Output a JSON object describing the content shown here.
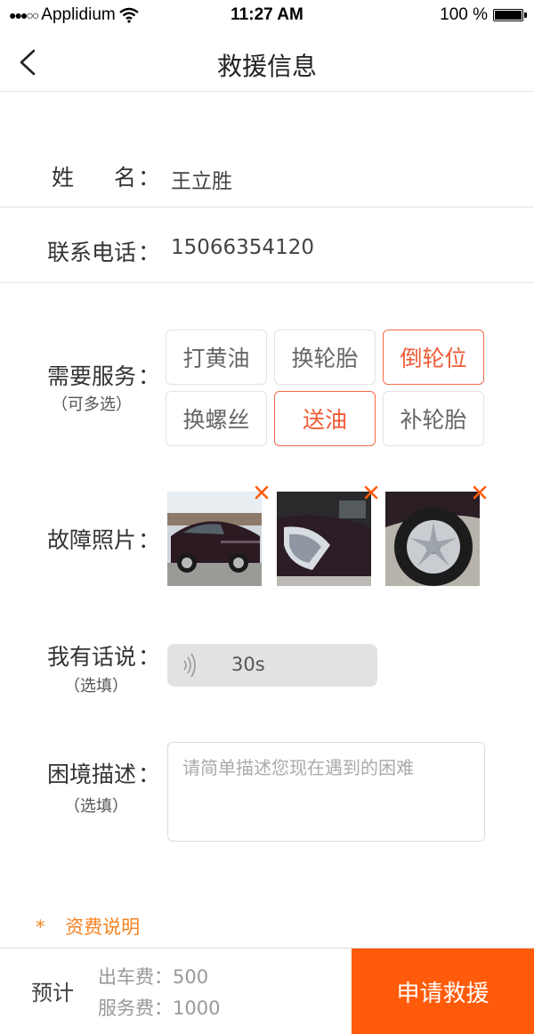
{
  "status_bar": {
    "signal_dots": "●●●○○",
    "carrier": "Applidium",
    "time": "11:27 AM",
    "battery": "100 %"
  },
  "nav": {
    "title": "救援信息"
  },
  "form": {
    "name_label_1": "姓",
    "name_label_2": "名",
    "colon": "：",
    "name_value": "王立胜",
    "phone_label": "联系电话",
    "phone_value": "15066354120",
    "service_label": "需要服务",
    "service_hint": "（可多选）",
    "services": [
      {
        "label": "打黄油",
        "selected": false
      },
      {
        "label": "换轮胎",
        "selected": false
      },
      {
        "label": "倒轮位",
        "selected": true
      },
      {
        "label": "换螺丝",
        "selected": false
      },
      {
        "label": "送油",
        "selected": true
      },
      {
        "label": "补轮胎",
        "selected": false
      }
    ],
    "photos_label": "故障照片",
    "photos": [
      {
        "subject": "car-side-photo"
      },
      {
        "subject": "car-headlight-photo"
      },
      {
        "subject": "car-wheel-photo"
      }
    ],
    "voice_label": "我有话说",
    "voice_hint": "（选填）",
    "voice_duration": "30s",
    "desc_label": "困境描述",
    "desc_hint": "（选填）",
    "desc_placeholder": "请简单描述您现在遇到的困难"
  },
  "fee_note": {
    "star": "*",
    "text": "资费说明"
  },
  "bottom_bar": {
    "estimate_label": "预计",
    "trip_fee_label": "出车费：",
    "trip_fee_value": "500",
    "service_fee_label": "服务费：",
    "service_fee_value": "1000",
    "submit_label": "申请救援"
  },
  "colors": {
    "accent": "#ff5b0a",
    "selected_border": "#f36a4a",
    "fee_link": "#f5821f"
  }
}
